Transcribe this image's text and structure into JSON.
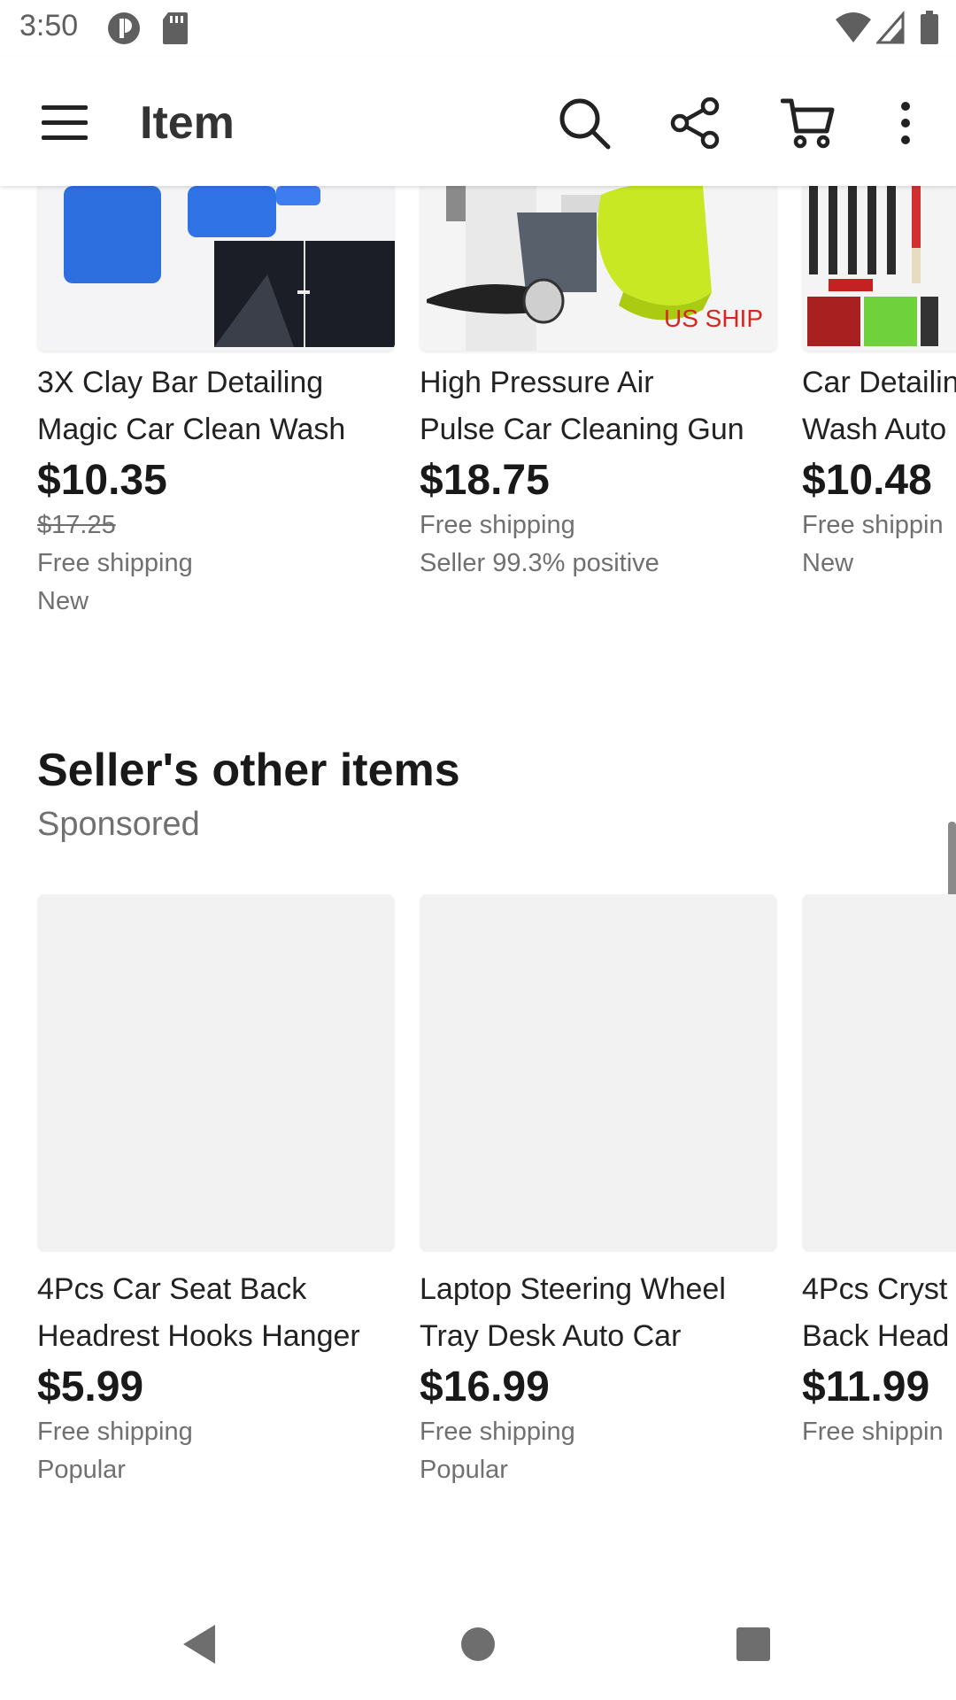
{
  "status_bar": {
    "time": "3:50"
  },
  "app_bar": {
    "title": "Item"
  },
  "top_row": [
    {
      "title_line1": "3X Clay Bar Detailing",
      "title_line2": "Magic Car Clean Wash",
      "price": "$10.35",
      "original_price": "$17.25",
      "shipping": "Free shipping",
      "extra": "New"
    },
    {
      "title_line1": "High Pressure Air",
      "title_line2": "Pulse Car Cleaning Gun",
      "price": "$18.75",
      "shipping": "Free shipping",
      "extra": "Seller 99.3% positive",
      "image_badge": "US SHIP"
    },
    {
      "title_line1": "Car Detailin",
      "title_line2": "Wash Auto",
      "price": "$10.48",
      "shipping": "Free shippin",
      "extra": "New"
    }
  ],
  "section": {
    "title": "Seller's other items",
    "subtitle": "Sponsored"
  },
  "bottom_row": [
    {
      "title_line1": "4Pcs Car Seat Back",
      "title_line2": "Headrest Hooks Hanger",
      "price": "$5.99",
      "shipping": "Free shipping",
      "extra": "Popular"
    },
    {
      "title_line1": "Laptop Steering Wheel",
      "title_line2": "Tray Desk Auto Car",
      "price": "$16.99",
      "shipping": "Free shipping",
      "extra": "Popular"
    },
    {
      "title_line1": "4Pcs Cryst",
      "title_line2": "Back Head",
      "price": "$11.99",
      "shipping": "Free shippin"
    }
  ]
}
